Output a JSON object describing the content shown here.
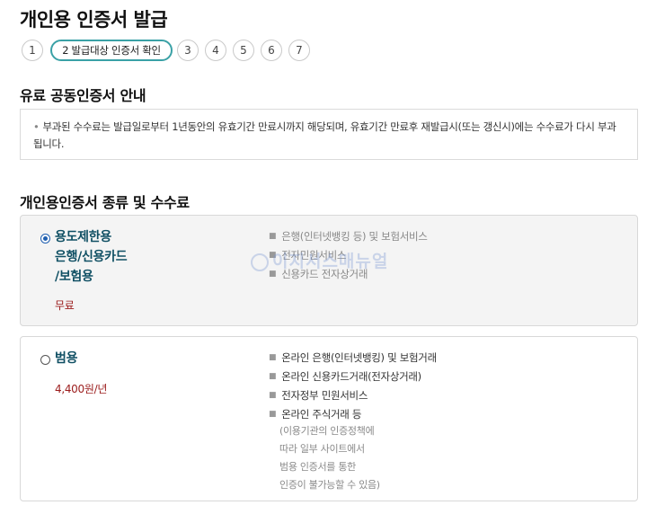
{
  "page": {
    "title": "개인용 인증서 발급"
  },
  "steps": [
    {
      "label": "1",
      "active": false
    },
    {
      "label": "2 발급대상 인증서 확인",
      "active": true
    },
    {
      "label": "3",
      "active": false
    },
    {
      "label": "4",
      "active": false
    },
    {
      "label": "5",
      "active": false
    },
    {
      "label": "6",
      "active": false
    },
    {
      "label": "7",
      "active": false
    }
  ],
  "notice": {
    "heading": "유료 공동인증서 안내",
    "text": "부과된 수수료는 발급일로부터 1년동안의 유효기간 만료시까지 해당되며, 유효기간 만료후 재발급시(또는 갱신시)에는 수수료가 다시 부과됩니다."
  },
  "certs": {
    "heading": "개인용인증서 종류 및 수수료",
    "limited": {
      "selected": true,
      "name_lines": [
        "용도제한용",
        "은행/신용카드",
        "/보험용"
      ],
      "fee": "무료",
      "features": [
        "은행(인터넷뱅킹 등) 및 보험서비스",
        "전자민원서비스",
        "신용카드 전자상거래"
      ],
      "watermark": "이지서스매뉴얼"
    },
    "general": {
      "selected": false,
      "name": "범용",
      "fee": "4,400원/년",
      "features": [
        "온라인 은행(인터넷뱅킹) 및 보험거래",
        "온라인 신용카드거래(전자상거래)",
        "전자정부 민원서비스",
        "온라인 주식거래 등"
      ],
      "note_lines": [
        "(이용기관의 인증정책에",
        "따라 일부 사이트에서",
        "범용 인증서를 통한",
        "인증이 불가능할 수 있음)"
      ]
    }
  },
  "colors": {
    "accent": "#3aa1a6",
    "name_color": "#0f4f63",
    "fee_color": "#9b1c1c",
    "radio": "#1f5fb0"
  }
}
